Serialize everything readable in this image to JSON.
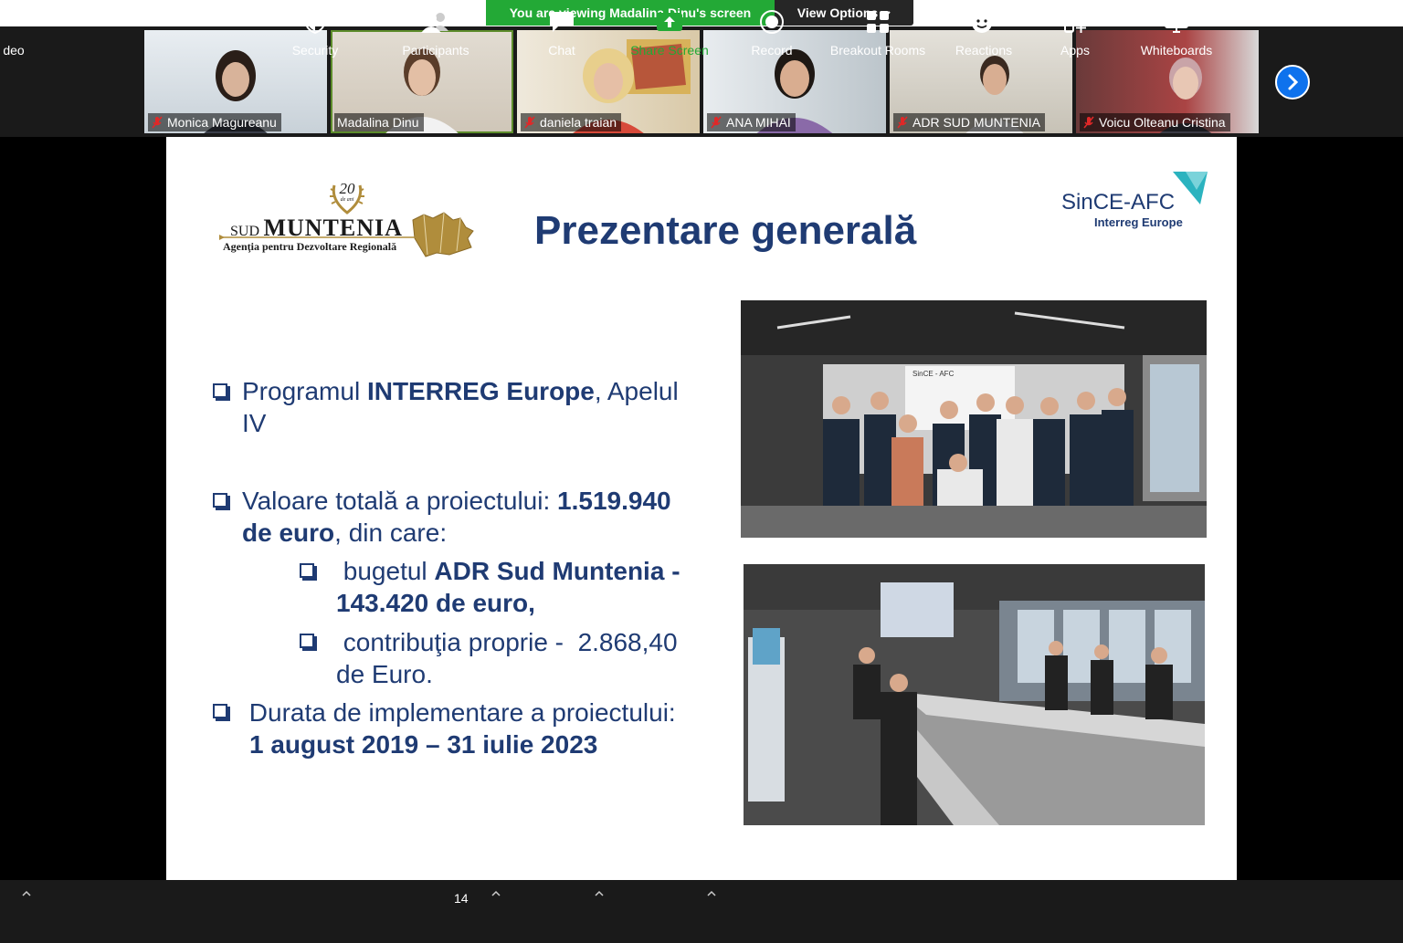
{
  "banner": {
    "viewing": "You are viewing Madalina Dinu's screen",
    "view_options": "View Options"
  },
  "participants": [
    {
      "name": "Monica Magureanu",
      "muted": true
    },
    {
      "name": "Madalina Dinu",
      "muted": false
    },
    {
      "name": "daniela traian",
      "muted": true
    },
    {
      "name": "ANA MIHAI",
      "muted": true
    },
    {
      "name": "ADR SUD MUNTENIA",
      "muted": true
    },
    {
      "name": "Voicu Olteanu Cristina",
      "muted": true
    }
  ],
  "slide": {
    "title": "Prezentare generală",
    "logo_left": {
      "years": "20",
      "years_sub": "de ani",
      "name_small": "SUD",
      "name_big": "MUNTENIA",
      "subtitle": "Agenţia pentru Dezvoltare Regională"
    },
    "logo_right": {
      "name": "SinCE-AFC",
      "subtitle": "Interreg Europe"
    },
    "bullet1": {
      "pre": "Programul ",
      "bold": "INTERREG Europe",
      "post": ", Apelul",
      "line2": "IV"
    },
    "bullet2": {
      "pre": "Valoare totală a proiectului: ",
      "bold1": "1.519.940",
      "bold2": "de euro",
      "post": ", din care:"
    },
    "sub1": {
      "pre": " bugetul ",
      "bold1": "ADR Sud Muntenia -",
      "bold2": "143.420 de euro,"
    },
    "sub2": {
      "line1": " contribuţia proprie -  2.868,40",
      "line2": "de Euro."
    },
    "bullet3": {
      "line1": " Durata de implementare a proiectului:",
      "bold": "1 august 2019 – 31 iulie 2023"
    },
    "poster_text": "SinCE - AFC"
  },
  "toolbar": {
    "video_partial": "deo",
    "security": "Security",
    "participants": "Participants",
    "participants_count": "14",
    "chat": "Chat",
    "share": "Share Screen",
    "record": "Record",
    "breakout": "Breakout Rooms",
    "reactions": "Reactions",
    "apps": "Apps",
    "whiteboards": "Whiteboards"
  },
  "colors": {
    "share_green": "#23a936",
    "zoom_blue": "#0e72ed",
    "slide_navy": "#1f3b73",
    "gold": "#b08d3c",
    "teal": "#2bb3bf"
  }
}
